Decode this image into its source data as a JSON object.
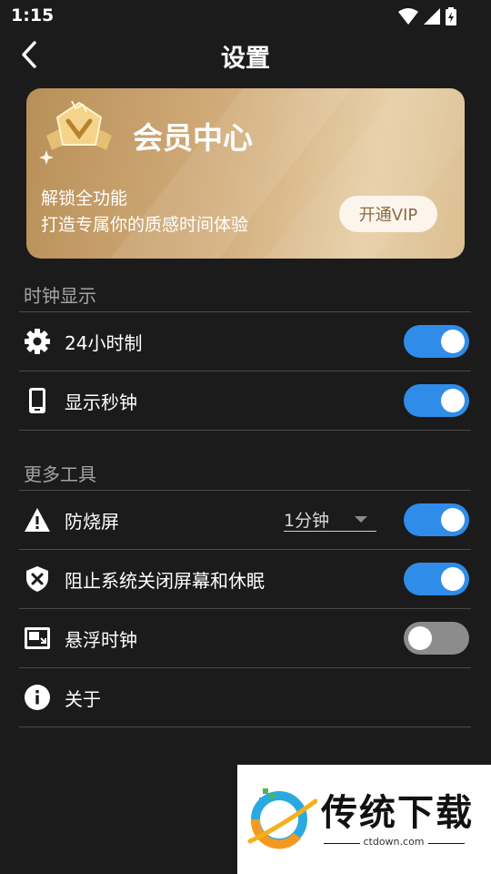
{
  "status_bar": {
    "time": "1:15"
  },
  "header": {
    "title": "设置"
  },
  "vip_card": {
    "title": "会员中心",
    "line1": "解锁全功能",
    "line2": "打造专属你的质感时间体验",
    "button": "开通VIP"
  },
  "sections": {
    "clock_display": "时钟显示",
    "more_tools": "更多工具"
  },
  "rows": {
    "hour24": {
      "label": "24小时制",
      "icon": "gear-icon",
      "enabled": true
    },
    "show_seconds": {
      "label": "显示秒钟",
      "icon": "phone-icon",
      "enabled": true
    },
    "burn_in": {
      "label": "防烧屏",
      "icon": "warning-icon",
      "dropdown_value": "1分钟",
      "enabled": true
    },
    "keep_awake": {
      "label": "阻止系统关闭屏幕和休眠",
      "icon": "shield-x-icon",
      "enabled": true
    },
    "floating_clock": {
      "label": "悬浮时钟",
      "icon": "picture-in-picture-icon",
      "enabled": false
    },
    "about": {
      "label": "关于",
      "icon": "info-icon"
    }
  },
  "watermark": {
    "text": "传统下载",
    "url": "ctdown.com"
  },
  "colors": {
    "accent": "#2f8ce8",
    "background": "#1b1b1b",
    "gold": "#d2ad7b"
  }
}
